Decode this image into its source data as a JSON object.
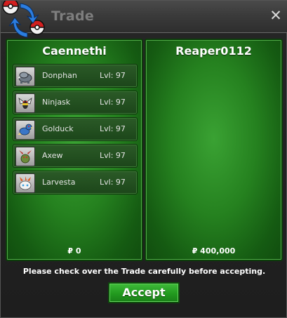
{
  "window": {
    "title": "Trade",
    "close_icon": "close-icon"
  },
  "colors": {
    "panel_green": "#25811f",
    "accept_green": "#229a1f",
    "title_text": "#7e7e7e"
  },
  "left_trader": {
    "name": "Caennethi",
    "money": "₽ 0",
    "pokemon": [
      {
        "name": "Donphan",
        "level": "Lvl: 97",
        "icon": "donphan-icon"
      },
      {
        "name": "Ninjask",
        "level": "Lvl: 97",
        "icon": "ninjask-icon"
      },
      {
        "name": "Golduck",
        "level": "Lvl: 97",
        "icon": "golduck-icon"
      },
      {
        "name": "Axew",
        "level": "Lvl: 97",
        "icon": "axew-icon"
      },
      {
        "name": "Larvesta",
        "level": "Lvl: 97",
        "icon": "larvesta-icon"
      }
    ]
  },
  "right_trader": {
    "name": "Reaper0112",
    "money": "₽ 400,000",
    "pokemon": []
  },
  "notice": "Please check over the Trade carefully before accepting.",
  "accept_label": "Accept"
}
